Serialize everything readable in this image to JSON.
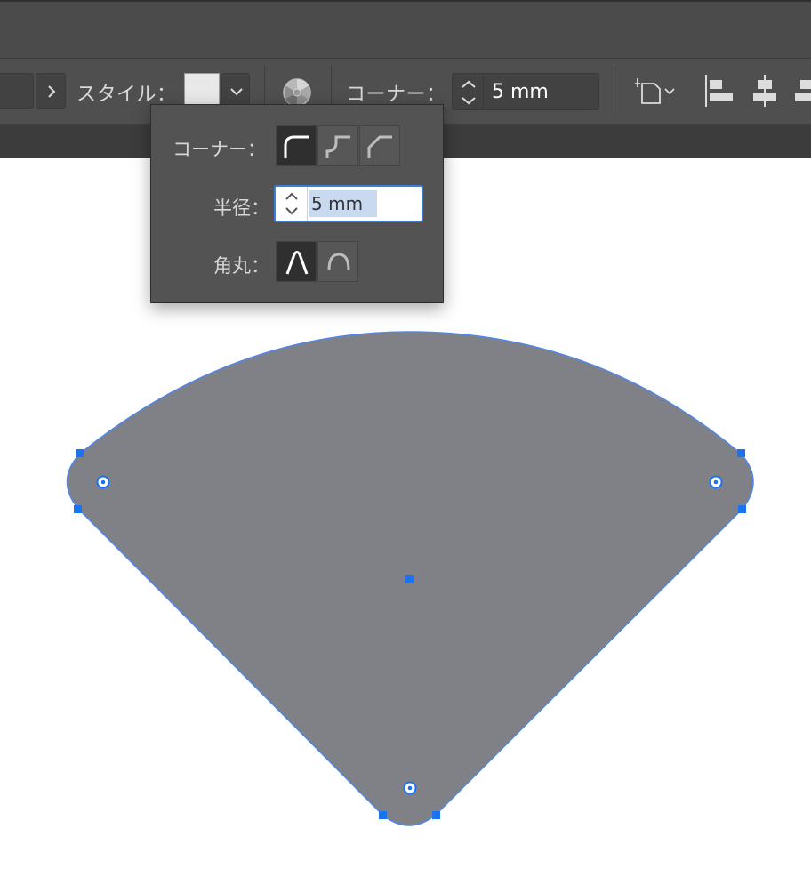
{
  "control_bar": {
    "style_label": "スタイル：",
    "corner_label": "コーナー：",
    "corner_value": "5 mm"
  },
  "popup": {
    "corner_label": "コーナー：",
    "radius_label": "半径：",
    "radius_value": "5 mm",
    "rounding_label": "角丸："
  },
  "icons": {
    "next": "chevron-right-icon",
    "style_dropdown": "chevron-down-icon",
    "recolor": "recolor-artwork-icon",
    "stepper": "stepper-icon",
    "transform": "transform-icon",
    "align_left": "align-left-icon",
    "align_center": "align-horizontal-center-icon",
    "align_right": "align-right-icon",
    "corner_round": "corner-round-icon",
    "corner_inverted": "corner-inverted-round-icon",
    "corner_chamfer": "corner-chamfer-icon",
    "rounding_absolute": "rounding-absolute-icon",
    "rounding_relative": "rounding-relative-icon"
  },
  "colors": {
    "shape_fill": "#808186",
    "selection_blue": "#1a74f0",
    "ui_dark": "#4f4f4f",
    "highlight": "#c9daf0"
  }
}
